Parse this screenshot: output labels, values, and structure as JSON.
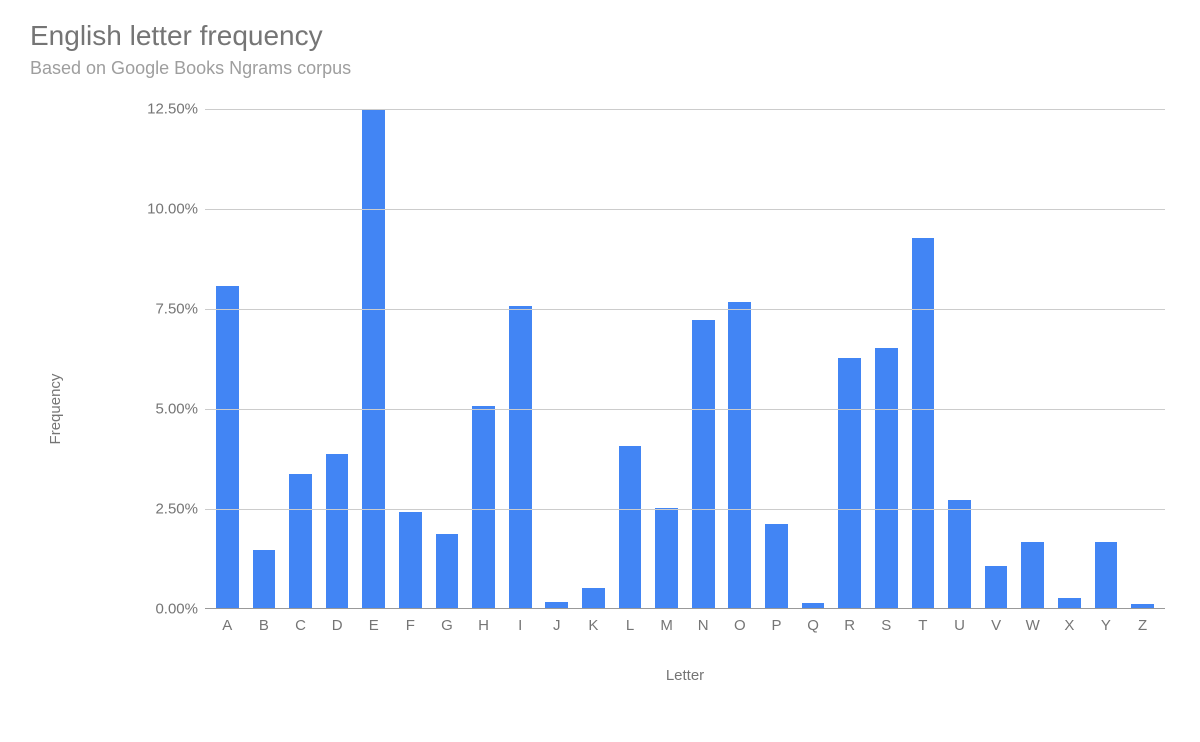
{
  "chart_data": {
    "type": "bar",
    "title": "English letter frequency",
    "subtitle": "Based on Google Books Ngrams corpus",
    "xlabel": "Letter",
    "ylabel": "Frequency",
    "ylim": [
      0,
      12.5
    ],
    "yticks": [
      0.0,
      2.5,
      5.0,
      7.5,
      10.0,
      12.5
    ],
    "ytick_labels": [
      "0.00%",
      "2.50%",
      "5.00%",
      "7.50%",
      "10.00%",
      "12.50%"
    ],
    "categories": [
      "A",
      "B",
      "C",
      "D",
      "E",
      "F",
      "G",
      "H",
      "I",
      "J",
      "K",
      "L",
      "M",
      "N",
      "O",
      "P",
      "Q",
      "R",
      "S",
      "T",
      "U",
      "V",
      "W",
      "X",
      "Y",
      "Z"
    ],
    "values": [
      8.04,
      1.45,
      3.35,
      3.85,
      12.45,
      2.4,
      1.85,
      5.05,
      7.55,
      0.15,
      0.5,
      4.05,
      2.5,
      7.2,
      7.65,
      2.1,
      0.12,
      6.25,
      6.5,
      9.25,
      2.7,
      1.05,
      1.65,
      0.25,
      1.65,
      0.09
    ]
  }
}
